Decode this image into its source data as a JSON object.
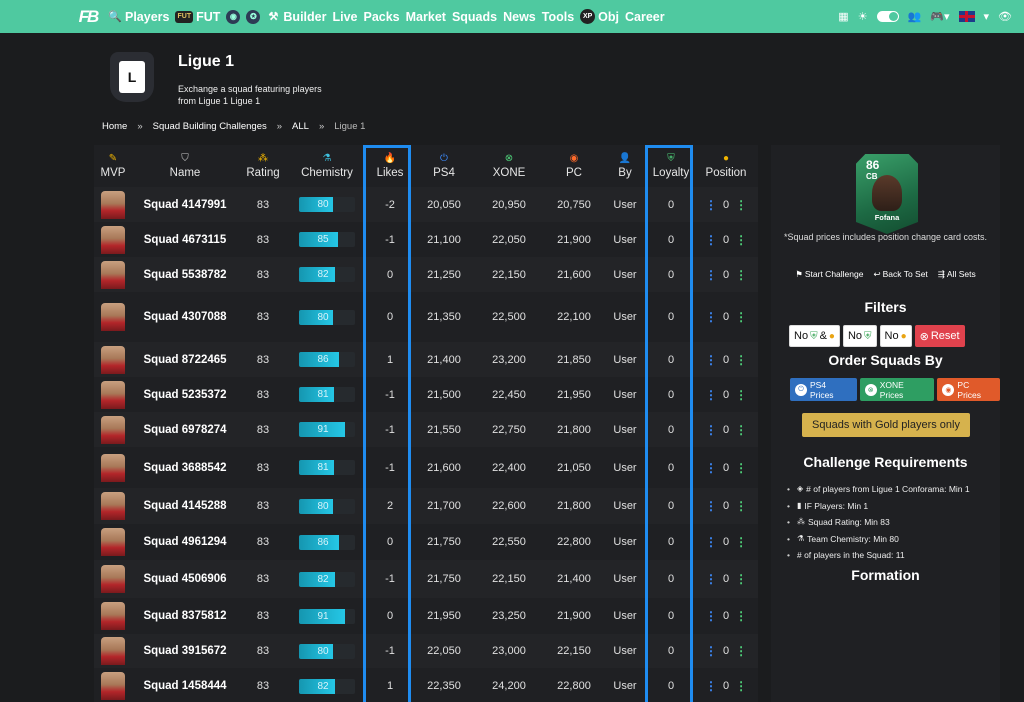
{
  "nav": {
    "logo": "FB",
    "items": [
      {
        "icon": "search-icon",
        "glyph": "🔍",
        "label": "Players"
      },
      {
        "icon": "fut-icon",
        "glyph": "FUT",
        "label": "FUT"
      },
      {
        "icon": "club-icon",
        "glyph": "◉",
        "label": ""
      },
      {
        "icon": "globe-icon",
        "glyph": "✪",
        "label": ""
      },
      {
        "icon": "tools-icon",
        "glyph": "⚒",
        "label": "Builder"
      },
      {
        "icon": "",
        "glyph": "",
        "label": "Live"
      },
      {
        "icon": "",
        "glyph": "",
        "label": "Packs"
      },
      {
        "icon": "",
        "glyph": "",
        "label": "Market"
      },
      {
        "icon": "",
        "glyph": "",
        "label": "Squads"
      },
      {
        "icon": "",
        "glyph": "",
        "label": "News"
      },
      {
        "icon": "",
        "glyph": "",
        "label": "Tools"
      },
      {
        "icon": "xp-icon",
        "glyph": "XP",
        "label": "Obj"
      },
      {
        "icon": "",
        "glyph": "",
        "label": "Career"
      }
    ]
  },
  "header": {
    "badge_letter": "L",
    "title": "Ligue 1",
    "description": "Exchange a squad featuring players from Ligue 1"
  },
  "breadcrumb": [
    "Home",
    "Squad Building Challenges",
    "ALL",
    "Ligue 1"
  ],
  "breadcrumb_sep": "»",
  "table": {
    "headers": {
      "mvp": "MVP",
      "name": "Name",
      "rating": "Rating",
      "chemistry": "Chemistry",
      "likes": "Likes",
      "ps4": "PS4",
      "xone": "XONE",
      "pc": "PC",
      "by": "By",
      "loyalty": "Loyalty",
      "position": "Position"
    },
    "rows": [
      {
        "name": "Squad 4147991",
        "rating": "83",
        "chem": 80,
        "likes": "-2",
        "ps4": "20,050",
        "xone": "20,950",
        "pc": "20,750",
        "by": "User",
        "loyalty": "0",
        "pos": "0"
      },
      {
        "name": "Squad 4673115",
        "rating": "83",
        "chem": 85,
        "likes": "-1",
        "ps4": "21,100",
        "xone": "22,050",
        "pc": "21,900",
        "by": "User",
        "loyalty": "0",
        "pos": "0"
      },
      {
        "name": "Squad 5538782",
        "rating": "83",
        "chem": 82,
        "likes": "0",
        "ps4": "21,250",
        "xone": "22,150",
        "pc": "21,600",
        "by": "User",
        "loyalty": "0",
        "pos": "0"
      },
      {
        "name": "Squad 4307088",
        "rating": "83",
        "chem": 80,
        "likes": "0",
        "ps4": "21,350",
        "xone": "22,500",
        "pc": "22,100",
        "by": "User",
        "loyalty": "0",
        "pos": "0"
      },
      {
        "name": "Squad 8722465",
        "rating": "83",
        "chem": 86,
        "likes": "1",
        "ps4": "21,400",
        "xone": "23,200",
        "pc": "21,850",
        "by": "User",
        "loyalty": "0",
        "pos": "0"
      },
      {
        "name": "Squad 5235372",
        "rating": "83",
        "chem": 81,
        "likes": "-1",
        "ps4": "21,500",
        "xone": "22,450",
        "pc": "21,950",
        "by": "User",
        "loyalty": "0",
        "pos": "0"
      },
      {
        "name": "Squad 6978274",
        "rating": "83",
        "chem": 91,
        "likes": "-1",
        "ps4": "21,550",
        "xone": "22,750",
        "pc": "21,800",
        "by": "User",
        "loyalty": "0",
        "pos": "0"
      },
      {
        "name": "Squad 3688542",
        "rating": "83",
        "chem": 81,
        "likes": "-1",
        "ps4": "21,600",
        "xone": "22,400",
        "pc": "21,050",
        "by": "User",
        "loyalty": "0",
        "pos": "0"
      },
      {
        "name": "Squad 4145288",
        "rating": "83",
        "chem": 80,
        "likes": "2",
        "ps4": "21,700",
        "xone": "22,600",
        "pc": "21,800",
        "by": "User",
        "loyalty": "0",
        "pos": "0"
      },
      {
        "name": "Squad 4961294",
        "rating": "83",
        "chem": 86,
        "likes": "0",
        "ps4": "21,750",
        "xone": "22,550",
        "pc": "22,800",
        "by": "User",
        "loyalty": "0",
        "pos": "0"
      },
      {
        "name": "Squad 4506906",
        "rating": "83",
        "chem": 82,
        "likes": "-1",
        "ps4": "21,750",
        "xone": "22,150",
        "pc": "21,400",
        "by": "User",
        "loyalty": "0",
        "pos": "0"
      },
      {
        "name": "Squad 8375812",
        "rating": "83",
        "chem": 91,
        "likes": "0",
        "ps4": "21,950",
        "xone": "23,250",
        "pc": "21,900",
        "by": "User",
        "loyalty": "0",
        "pos": "0"
      },
      {
        "name": "Squad 3915672",
        "rating": "83",
        "chem": 80,
        "likes": "-1",
        "ps4": "22,050",
        "xone": "23,000",
        "pc": "22,150",
        "by": "User",
        "loyalty": "0",
        "pos": "0"
      },
      {
        "name": "Squad 1458444",
        "rating": "83",
        "chem": 82,
        "likes": "1",
        "ps4": "22,350",
        "xone": "24,200",
        "pc": "22,800",
        "by": "User",
        "loyalty": "0",
        "pos": "0"
      }
    ]
  },
  "side": {
    "card": {
      "rating": "86",
      "position": "CB",
      "name": "Fofana"
    },
    "note": "*Squad prices includes position change card costs.",
    "links": [
      {
        "icon": "flag-icon",
        "glyph": "⚑",
        "label": "Start Challenge"
      },
      {
        "icon": "back-icon",
        "glyph": "↩",
        "label": "Back To Set"
      },
      {
        "icon": "sets-icon",
        "glyph": "⇶",
        "label": "All Sets"
      }
    ],
    "filters_title": "Filters",
    "filters": {
      "no": "No",
      "and": "&",
      "reset": "Reset"
    },
    "order_title": "Order Squads By",
    "order": {
      "ps4": "PS4 Prices",
      "xone": "XONE Prices",
      "pc": "PC Prices"
    },
    "gold_only": "Squads with Gold players only",
    "requirements_title": "Challenge Requirements",
    "requirements": [
      {
        "icon": "league-icon",
        "glyph": "◈",
        "text": "# of players from Ligue 1 Conforama: Min 1"
      },
      {
        "icon": "if-icon",
        "glyph": "▮",
        "text": "IF Players: Min 1"
      },
      {
        "icon": "rating-icon",
        "glyph": "⁂",
        "text": "Squad Rating: Min 83"
      },
      {
        "icon": "chemistry-icon",
        "glyph": "⚗",
        "text": "Team Chemistry: Min 80"
      },
      {
        "icon": "",
        "glyph": "",
        "text": "# of players in the Squad: 11"
      }
    ],
    "formation_title": "Formation"
  },
  "colors": {
    "nav_bg": "#4fc9a0",
    "highlight": "#1f8cf0",
    "chem_bar": "#25c7e6",
    "reset": "#e0424d",
    "gold": "#d6b24d"
  }
}
